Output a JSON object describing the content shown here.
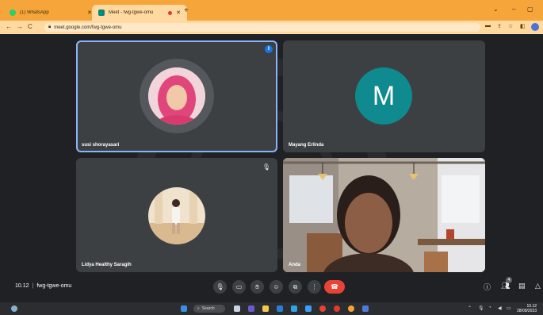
{
  "browser": {
    "tabs": [
      {
        "title": "(1) WhatsApp",
        "icon": "whatsapp-icon"
      },
      {
        "title": "Meet - fwg-tgwe-omu",
        "icon": "meet-icon"
      }
    ],
    "url": "meet.google.com/fwg-tgwe-omu"
  },
  "meet": {
    "participants": [
      {
        "name": "susi shorayasari"
      },
      {
        "name": "Mayang Erlinda",
        "initial": "M"
      },
      {
        "name": "Lidya Healthy Saragih"
      },
      {
        "name": "Anda"
      }
    ],
    "time": "10.12",
    "code": "fwg-tgwe-omu",
    "people_count": "4"
  },
  "taskbar": {
    "search_label": "Search",
    "clock_time": "10.12",
    "clock_date": "28/09/2023"
  },
  "colors": {
    "accent": "#8ab4f8",
    "end_call": "#ea4335",
    "tab_strip": "#f6a53a",
    "avatar_m": "#0f8a8f"
  }
}
